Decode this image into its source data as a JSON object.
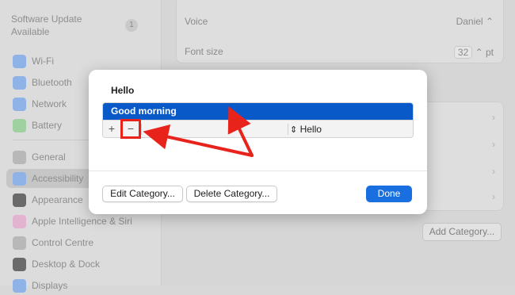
{
  "sidebar": {
    "software_update": "Software Update Available",
    "update_count": "1",
    "items": [
      {
        "label": "Wi-Fi",
        "icon": "wifi-icon",
        "color": "#6da0e6"
      },
      {
        "label": "Bluetooth",
        "icon": "bluetooth-icon",
        "color": "#6da0e6"
      },
      {
        "label": "Network",
        "icon": "network-icon",
        "color": "#6da0e6"
      },
      {
        "label": "Battery",
        "icon": "battery-icon",
        "color": "#7fc97f"
      },
      {
        "label": "General",
        "icon": "gear-icon",
        "color": "#a8a8a8"
      },
      {
        "label": "Accessibility",
        "icon": "accessibility-icon",
        "color": "#6da0e6"
      },
      {
        "label": "Appearance",
        "icon": "appearance-icon",
        "color": "#3a3a3a"
      },
      {
        "label": "Apple Intelligence & Siri",
        "icon": "siri-icon",
        "color": "#e6a0c8"
      },
      {
        "label": "Control Centre",
        "icon": "control-centre-icon",
        "color": "#a8a8a8"
      },
      {
        "label": "Desktop & Dock",
        "icon": "dock-icon",
        "color": "#3a3a3a"
      },
      {
        "label": "Displays",
        "icon": "display-icon",
        "color": "#6da0e6"
      }
    ]
  },
  "main": {
    "voice_label": "Voice",
    "voice_value": "Daniel",
    "font_size_label": "Font size",
    "font_size_value": "32",
    "font_size_unit": "pt",
    "add_category_button": "Add Category..."
  },
  "dialog": {
    "title": "Hello",
    "selected_row": "Good morning",
    "add_glyph": "+",
    "remove_glyph": "−",
    "popup_value": "Hello",
    "edit_category_button": "Edit Category...",
    "delete_category_button": "Delete Category...",
    "done_button": "Done"
  },
  "colors": {
    "accent": "#0a59c9",
    "annotation": "#e8231c"
  }
}
